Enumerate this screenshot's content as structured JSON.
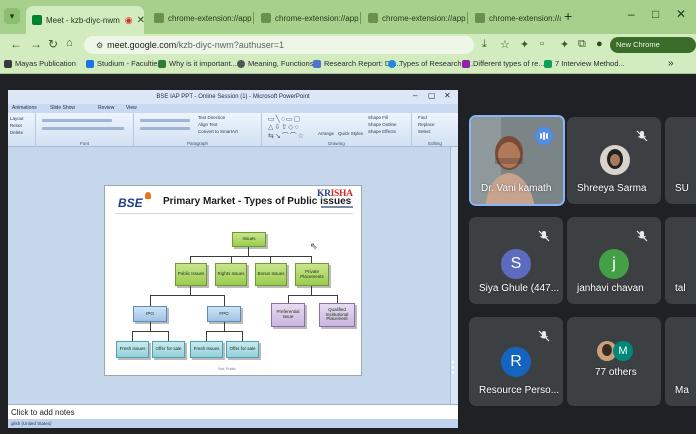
{
  "browser": {
    "tabs": [
      {
        "label": "Meet - kzb-diyc-nwm",
        "active": true
      },
      {
        "label": "chrome-extension://appcm"
      },
      {
        "label": "chrome-extension://appcm"
      },
      {
        "label": "chrome-extension://appcm"
      },
      {
        "label": "chrome-extension://appcm"
      }
    ],
    "new_tab": "+",
    "window_controls": {
      "minimize": "–",
      "maximize": "□",
      "close": "✕"
    },
    "url_host": "meet.google.com",
    "url_path": "/kzb-diyc-nwm?authuser=1",
    "update_button": "New Chrome available",
    "bookmarks": [
      {
        "label": "Mayas Publication",
        "color": "#3a3a3a"
      },
      {
        "label": "Studium - Faculties",
        "color": "#1a73e8"
      },
      {
        "label": "Why is it important...",
        "color": "#2e7d32"
      },
      {
        "label": "Meaning, Functions...",
        "color": "#555555"
      },
      {
        "label": "Research Report: De...",
        "color": "#4a76d1"
      },
      {
        "label": "Types of Research R...",
        "color": "#1e88e5"
      },
      {
        "label": "Different types of re...",
        "color": "#8e24aa"
      },
      {
        "label": "7 Interview Method...",
        "color": "#0f9d58"
      }
    ],
    "bookmarks_more": "»"
  },
  "presentation": {
    "window_title": "BSE IAP PPT - Online Session (1) - Microsoft PowerPoint",
    "ribbon_tabs": [
      "Animations",
      "Slide Show",
      "Review",
      "View"
    ],
    "ribbon_groups": [
      "Font",
      "Paragraph",
      "Drawing",
      "Editing"
    ],
    "ribbon_items": {
      "layout": "Layout",
      "reset": "Reset",
      "delete": "Delete",
      "text_direction": "Text Direction",
      "align_text": "Align Text",
      "convert_smartart": "Convert to SmartArt",
      "arrange": "Arrange",
      "quick_styles": "Quick Styles",
      "shape_fill": "Shape Fill",
      "shape_outline": "Shape Outline",
      "shape_effects": "Shape Effects",
      "find": "Find",
      "replace": "Replace",
      "select": "Select"
    },
    "notes_placeholder": "Click to add notes",
    "status_language": "glish (United States)",
    "slide": {
      "logo": "BSE",
      "title": "Primary Market - Types of Public issues",
      "brand": "KR",
      "brand_accent": "ISHA",
      "footer": "Sub: Public",
      "nodes": {
        "issues": "Issues",
        "public": "Public Issues",
        "rights": "Rights Issues",
        "bonus": "Bonus Issues",
        "private": "Private Placements",
        "ipo": "IPO",
        "fpo": "FPO",
        "preferential": "Preferential Issue",
        "qip": "Qualified Institutional Placement",
        "fresh1": "Fresh Issues",
        "ofs1": "Offer for sale",
        "fresh2": "Fresh Issues",
        "ofs2": "Offer for sale"
      }
    }
  },
  "participants": [
    {
      "name": "Dr. Vani kamath",
      "type": "video",
      "speaking": true
    },
    {
      "name": "Shreeya Sarma",
      "type": "photo",
      "muted": true
    },
    {
      "name": "SU",
      "type": "cut"
    },
    {
      "name": "Siya Ghule (447...",
      "initial": "S",
      "color": "#5c6bc0",
      "muted": true
    },
    {
      "name": "janhavi chavan",
      "initial": "j",
      "color": "#43a047",
      "muted": true
    },
    {
      "name": "tal",
      "type": "cut"
    },
    {
      "name": "Resource Perso...",
      "initial": "R",
      "color": "#1565c0",
      "muted": true
    },
    {
      "name": "77 others",
      "type": "others",
      "initial": "M",
      "color": "#00897b"
    },
    {
      "name": "Ma",
      "type": "cut"
    }
  ]
}
